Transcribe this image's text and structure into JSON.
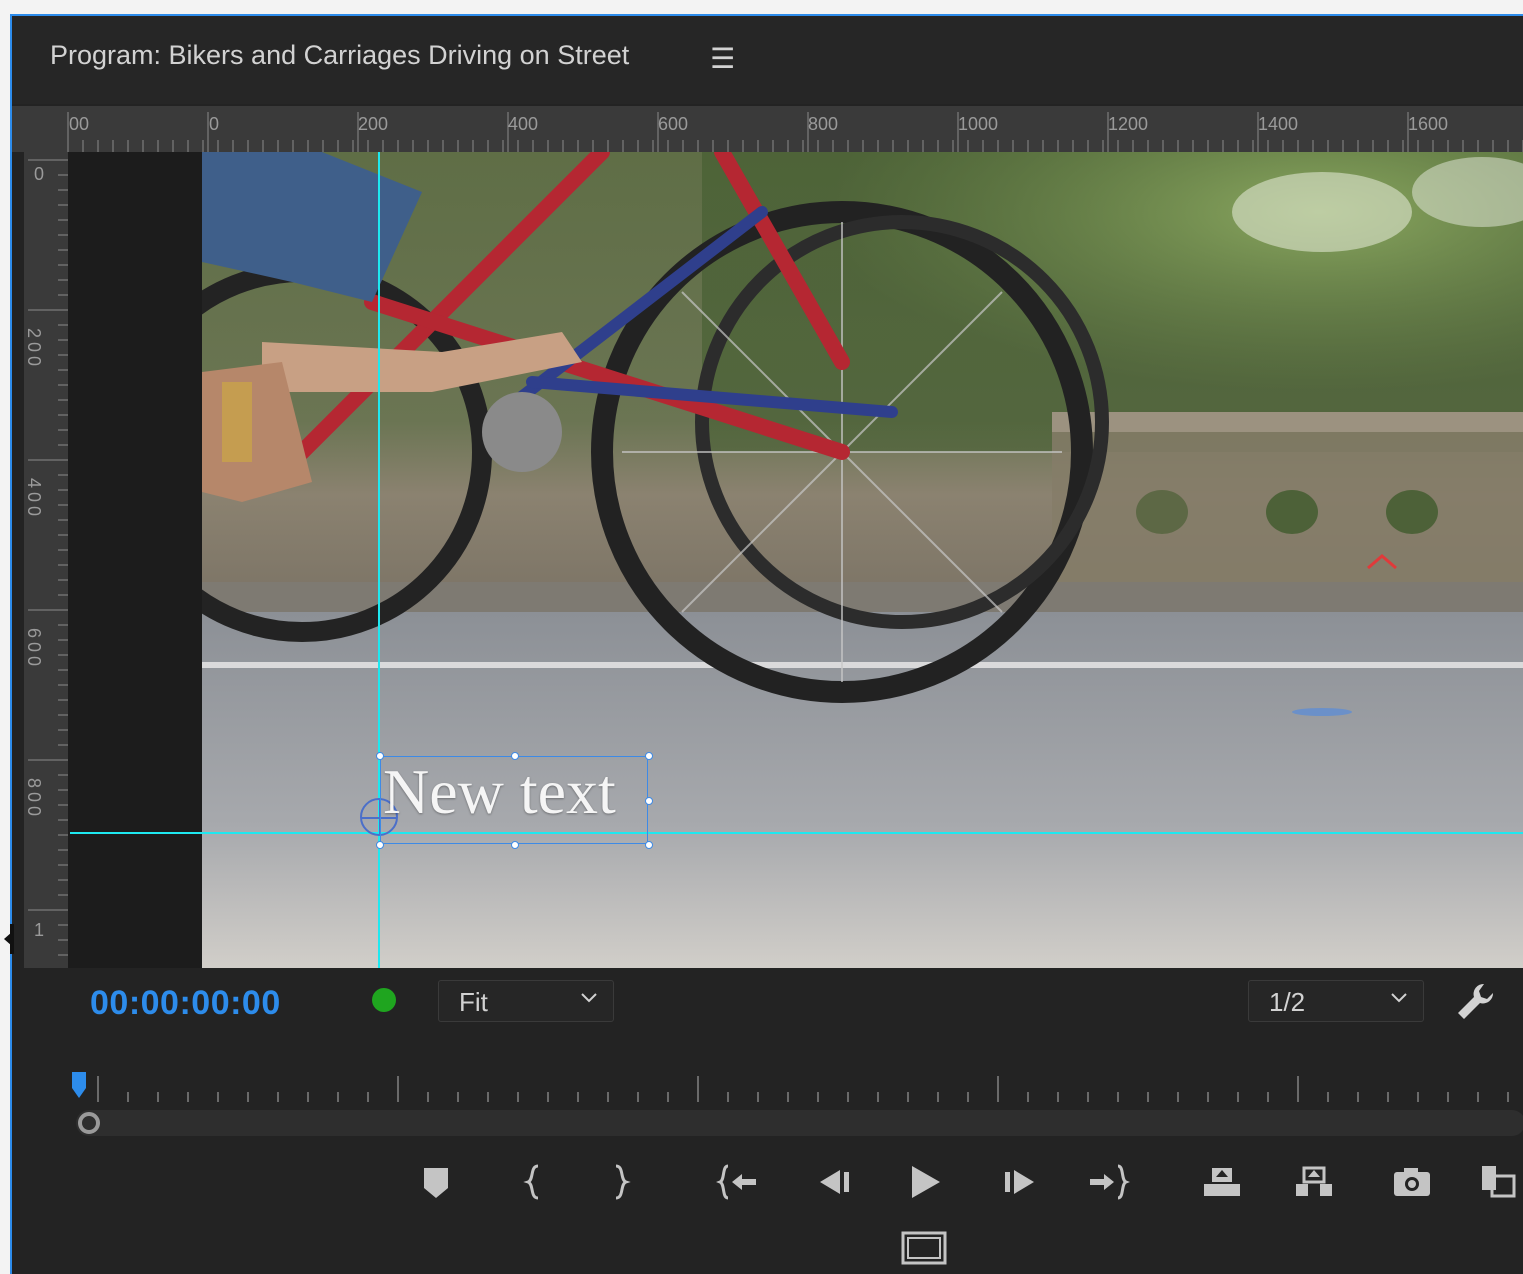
{
  "panel": {
    "title": "Program: Bikers and Carriages Driving on Street",
    "menu_icon": "hamburger-menu-icon"
  },
  "rulers": {
    "top_labels": [
      "00",
      "0",
      "200",
      "400",
      "600",
      "800",
      "1000",
      "1200",
      "1400",
      "1600"
    ],
    "left_labels": [
      "0",
      "200",
      "400",
      "600",
      "800",
      "1"
    ]
  },
  "viewer": {
    "text_layer": "New text",
    "guide_color": "#1ee8f0"
  },
  "controls": {
    "timecode": "00:00:00:00",
    "zoom": "Fit",
    "resolution": "1/2",
    "accent_color": "#2d8ceb"
  },
  "transport": {
    "buttons": [
      "add-marker",
      "mark-in",
      "mark-out",
      "go-to-in",
      "step-back",
      "play",
      "step-forward",
      "go-to-out",
      "lift",
      "extract",
      "export-frame",
      "button-editor"
    ]
  }
}
